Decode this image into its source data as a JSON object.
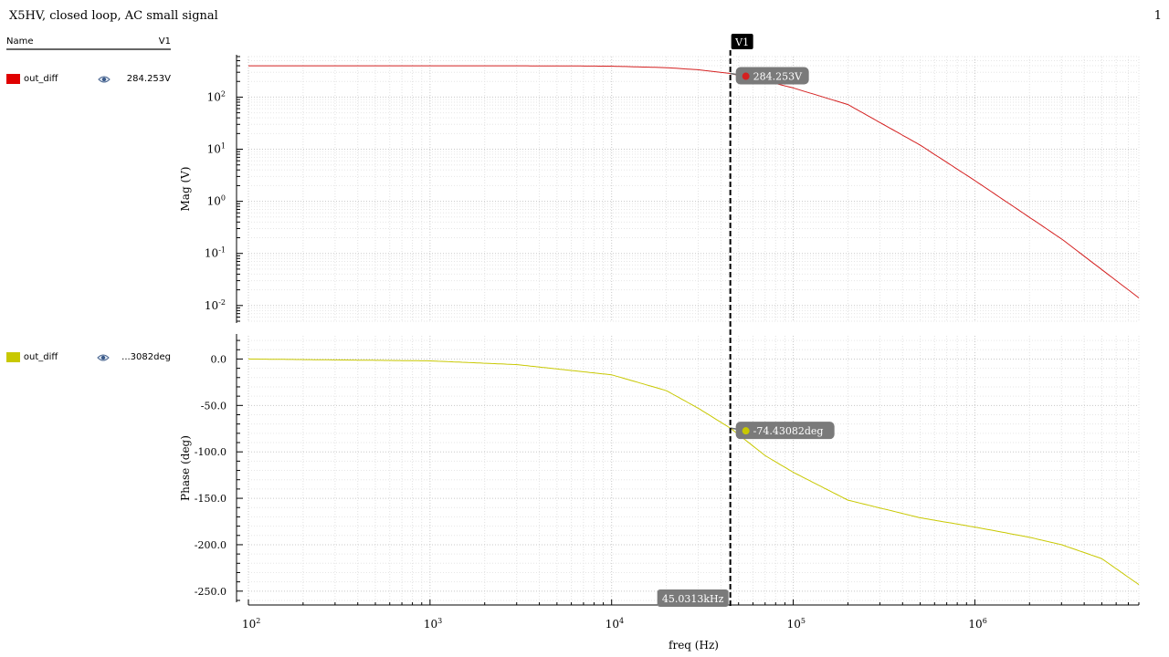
{
  "window": {
    "title": "X5HV, closed loop, AC small signal",
    "page_number": "1"
  },
  "legend": {
    "header_name": "Name",
    "header_value": "V1",
    "rows": [
      {
        "signal": "out_diff",
        "value": "284.253V",
        "color": "#e00000",
        "icon": "eye-icon"
      },
      {
        "signal": "out_diff",
        "value": "...3082deg",
        "color": "#c8c800",
        "icon": "eye-icon"
      }
    ]
  },
  "cursor": {
    "label": "V1",
    "x": 45031.3,
    "x_label": "45.0313kHz"
  },
  "chart_data": [
    {
      "type": "line",
      "ylabel": "Mag (V)",
      "xscale": "log",
      "yscale": "log",
      "xlim": [
        100,
        8000000
      ],
      "ylim": [
        0.005,
        600
      ],
      "y_ticks": [
        {
          "value": 100,
          "base": "10",
          "exp": "2"
        },
        {
          "value": 10,
          "base": "10",
          "exp": "1"
        },
        {
          "value": 1,
          "base": "10",
          "exp": "0"
        },
        {
          "value": 0.1,
          "base": "10",
          "exp": "-1"
        },
        {
          "value": 0.01,
          "base": "10",
          "exp": "-2"
        }
      ],
      "grid": true,
      "series": [
        {
          "color": "#d42020",
          "x": [
            100,
            1000,
            5000,
            10000,
            20000,
            30000,
            45031.3,
            70000,
            100000,
            200000,
            500000,
            1000000,
            3000000,
            8000000
          ],
          "y": [
            400,
            400,
            398,
            392,
            368,
            335,
            284.253,
            205,
            150,
            72,
            12,
            2.5,
            0.19,
            0.014
          ]
        }
      ],
      "marker": {
        "x": 45031.3,
        "y": 284.253,
        "label": "284.253V"
      }
    },
    {
      "type": "line",
      "ylabel": "Phase (deg)",
      "xscale": "log",
      "yscale": "linear",
      "xlim": [
        100,
        8000000
      ],
      "ylim": [
        -260,
        25
      ],
      "y_ticks": [
        {
          "value": 0,
          "text": "0.0"
        },
        {
          "value": -50,
          "text": "-50.0"
        },
        {
          "value": -100,
          "text": "-100.0"
        },
        {
          "value": -150,
          "text": "-150.0"
        },
        {
          "value": -200,
          "text": "-200.0"
        },
        {
          "value": -250,
          "text": "-250.0"
        }
      ],
      "grid": true,
      "series": [
        {
          "color": "#c8c800",
          "x": [
            100,
            1000,
            3000,
            10000,
            20000,
            30000,
            45031.3,
            70000,
            100000,
            200000,
            500000,
            1000000,
            2000000,
            3000000,
            5000000,
            8000000
          ],
          "y": [
            0,
            -2,
            -6,
            -17,
            -34,
            -53,
            -74.43082,
            -104,
            -122,
            -152,
            -171,
            -181,
            -192,
            -200,
            -215,
            -243
          ]
        }
      ],
      "marker": {
        "x": 45031.3,
        "y": -74.43082,
        "label": "-74.43082deg"
      }
    }
  ],
  "x_axis": {
    "label": "freq (Hz)",
    "ticks": [
      {
        "value": 100,
        "base": "10",
        "exp": "2"
      },
      {
        "value": 1000,
        "base": "10",
        "exp": "3"
      },
      {
        "value": 10000,
        "base": "10",
        "exp": "4"
      },
      {
        "value": 100000,
        "base": "10",
        "exp": "5"
      },
      {
        "value": 1000000,
        "base": "10",
        "exp": "6"
      }
    ]
  }
}
